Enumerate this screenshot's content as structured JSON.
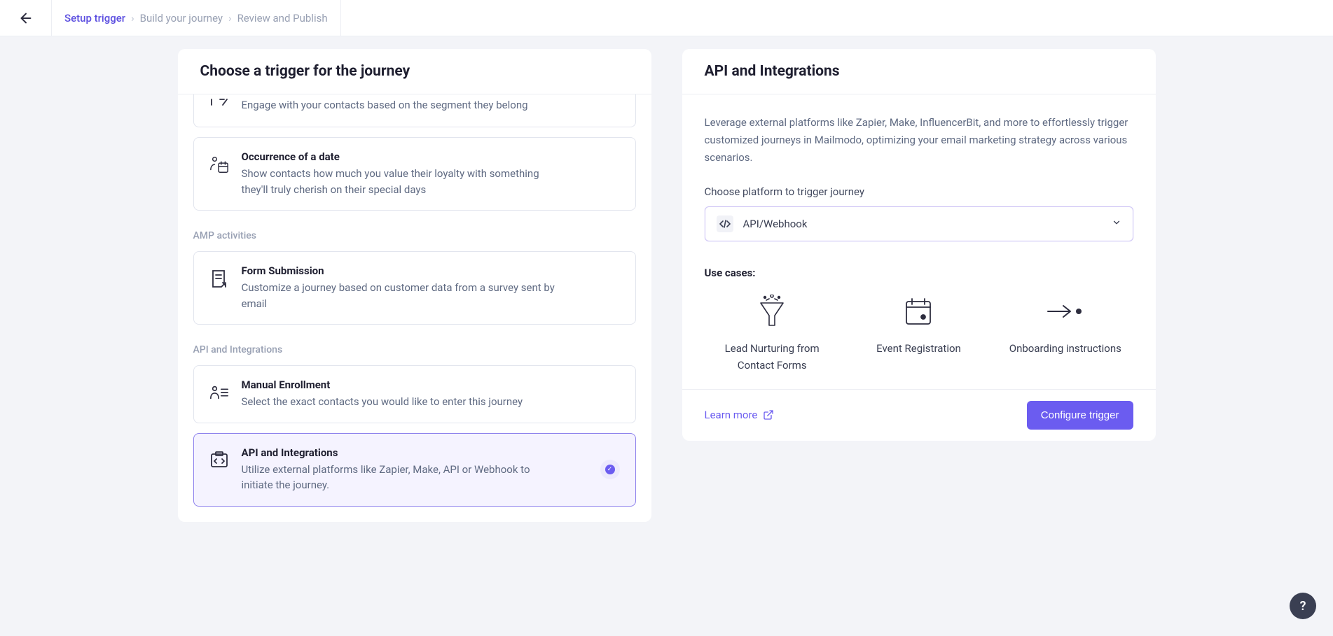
{
  "breadcrumb": {
    "items": [
      "Setup trigger",
      "Build your journey",
      "Review and Publish"
    ],
    "active_index": 0
  },
  "left_panel": {
    "title": "Choose a trigger for the journey",
    "partial_card": {
      "desc": "Engage with your contacts based on the segment they belong"
    },
    "occurrence": {
      "title": "Occurrence of a date",
      "desc": "Show contacts how much you value their loyalty with something they'll truly cherish on their special days"
    },
    "section_amp": "AMP activities",
    "form_submission": {
      "title": "Form Submission",
      "desc": "Customize a journey based on customer data from a survey sent by email"
    },
    "section_api": "API and Integrations",
    "manual": {
      "title": "Manual Enrollment",
      "desc": "Select the exact contacts you would like to enter this journey"
    },
    "api_integrations": {
      "title": "API and Integrations",
      "desc": "Utilize external platforms like Zapier, Make, API or Webhook to initiate the journey."
    }
  },
  "right_panel": {
    "title": "API and Integrations",
    "intro": "Leverage external platforms like Zapier, Make, InfluencerBit, and more to effortlessly trigger customized journeys in Mailmodo, optimizing your email marketing strategy across various scenarios.",
    "choose_platform_label": "Choose platform to trigger journey",
    "selected_platform": "API/Webhook",
    "usecases_label": "Use cases:",
    "usecases": [
      "Lead Nurturing from Contact Forms",
      "Event Registration",
      "Onboarding instructions"
    ],
    "learn_more": "Learn more",
    "configure_button": "Configure trigger"
  },
  "help_fab": "?"
}
